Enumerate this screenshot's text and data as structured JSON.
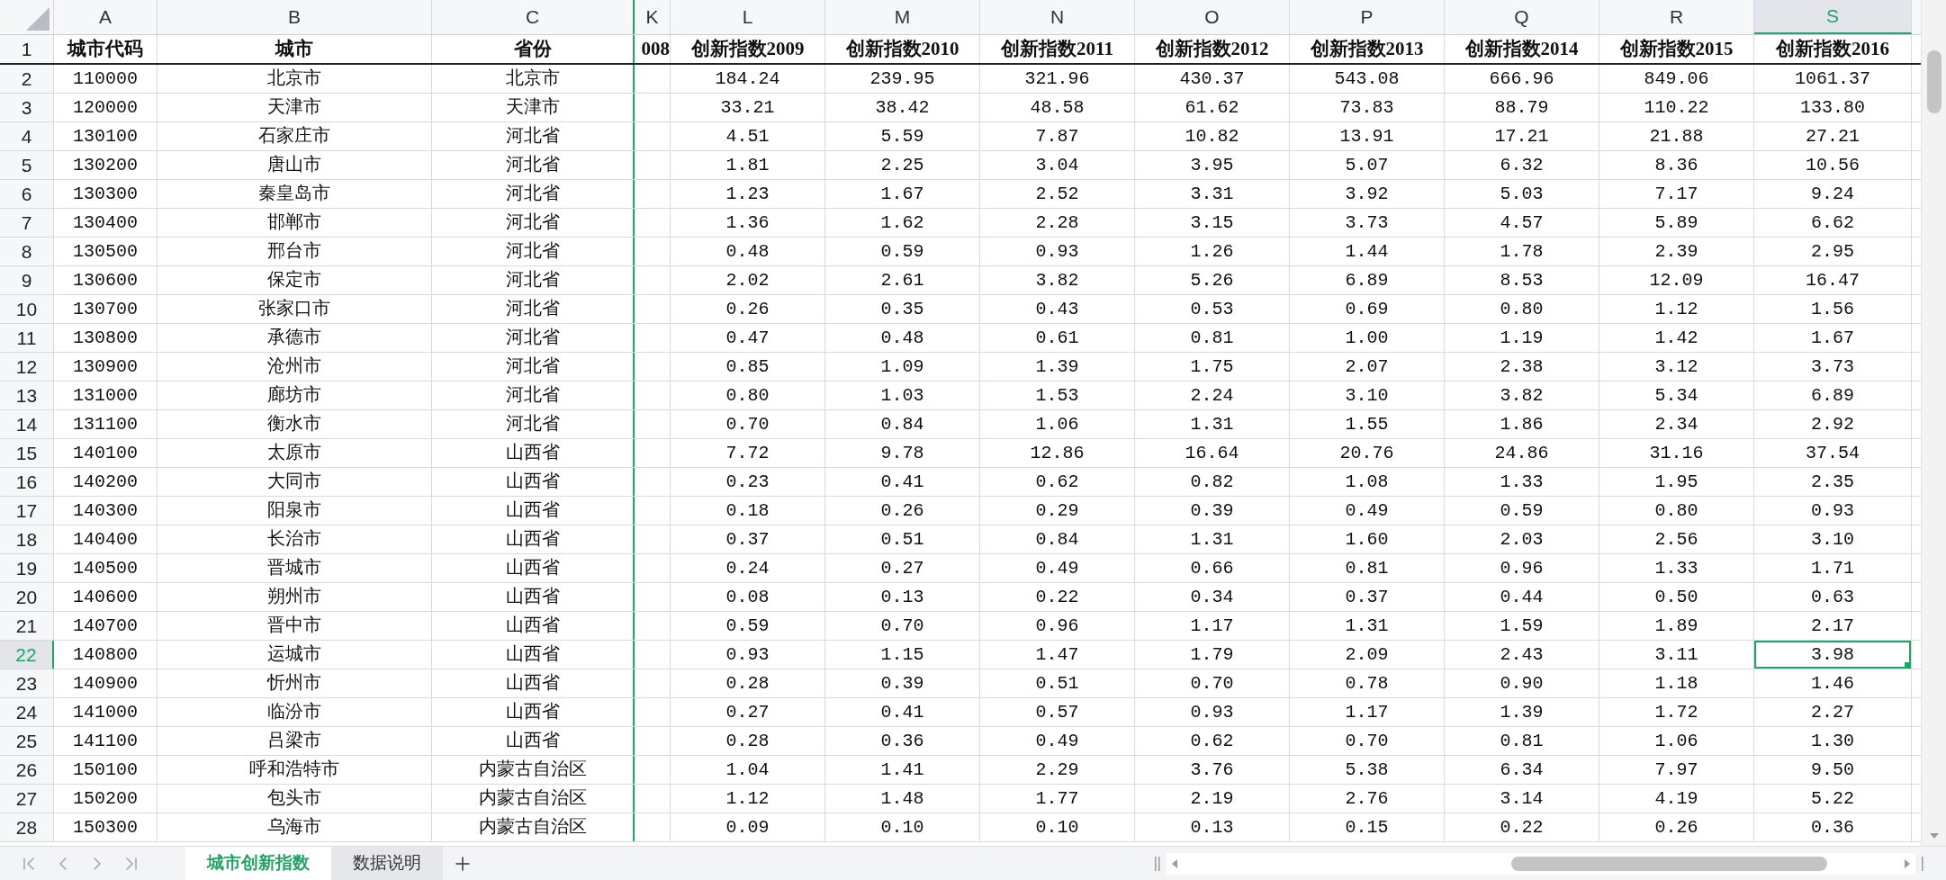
{
  "column_headers": [
    {
      "label": "A",
      "selected": false
    },
    {
      "label": "B",
      "selected": false
    },
    {
      "label": "C",
      "selected": false
    },
    {
      "label": "K",
      "selected": false
    },
    {
      "label": "L",
      "selected": false
    },
    {
      "label": "M",
      "selected": false
    },
    {
      "label": "N",
      "selected": false
    },
    {
      "label": "O",
      "selected": false
    },
    {
      "label": "P",
      "selected": false
    },
    {
      "label": "Q",
      "selected": false
    },
    {
      "label": "R",
      "selected": false
    },
    {
      "label": "S",
      "selected": true
    }
  ],
  "rows": [
    {
      "number": "1",
      "kind": "header",
      "selected": false,
      "cells": [
        "城市代码",
        "城市",
        "省份",
        "008",
        "创新指数2009",
        "创新指数2010",
        "创新指数2011",
        "创新指数2012",
        "创新指数2013",
        "创新指数2014",
        "创新指数2015",
        "创新指数2016"
      ]
    },
    {
      "number": "2",
      "kind": "data",
      "selected": false,
      "cells": [
        "110000",
        "北京市",
        "北京市",
        null,
        "184.24",
        "239.95",
        "321.96",
        "430.37",
        "543.08",
        "666.96",
        "849.06",
        "1061.37"
      ]
    },
    {
      "number": "3",
      "kind": "data",
      "selected": false,
      "cells": [
        "120000",
        "天津市",
        "天津市",
        null,
        "33.21",
        "38.42",
        "48.58",
        "61.62",
        "73.83",
        "88.79",
        "110.22",
        "133.80"
      ]
    },
    {
      "number": "4",
      "kind": "data",
      "selected": false,
      "cells": [
        "130100",
        "石家庄市",
        "河北省",
        null,
        "4.51",
        "5.59",
        "7.87",
        "10.82",
        "13.91",
        "17.21",
        "21.88",
        "27.21"
      ]
    },
    {
      "number": "5",
      "kind": "data",
      "selected": false,
      "cells": [
        "130200",
        "唐山市",
        "河北省",
        null,
        "1.81",
        "2.25",
        "3.04",
        "3.95",
        "5.07",
        "6.32",
        "8.36",
        "10.56"
      ]
    },
    {
      "number": "6",
      "kind": "data",
      "selected": false,
      "cells": [
        "130300",
        "秦皇岛市",
        "河北省",
        null,
        "1.23",
        "1.67",
        "2.52",
        "3.31",
        "3.92",
        "5.03",
        "7.17",
        "9.24"
      ]
    },
    {
      "number": "7",
      "kind": "data",
      "selected": false,
      "cells": [
        "130400",
        "邯郸市",
        "河北省",
        null,
        "1.36",
        "1.62",
        "2.28",
        "3.15",
        "3.73",
        "4.57",
        "5.89",
        "6.62"
      ]
    },
    {
      "number": "8",
      "kind": "data",
      "selected": false,
      "cells": [
        "130500",
        "邢台市",
        "河北省",
        null,
        "0.48",
        "0.59",
        "0.93",
        "1.26",
        "1.44",
        "1.78",
        "2.39",
        "2.95"
      ]
    },
    {
      "number": "9",
      "kind": "data",
      "selected": false,
      "cells": [
        "130600",
        "保定市",
        "河北省",
        null,
        "2.02",
        "2.61",
        "3.82",
        "5.26",
        "6.89",
        "8.53",
        "12.09",
        "16.47"
      ]
    },
    {
      "number": "10",
      "kind": "data",
      "selected": false,
      "cells": [
        "130700",
        "张家口市",
        "河北省",
        null,
        "0.26",
        "0.35",
        "0.43",
        "0.53",
        "0.69",
        "0.80",
        "1.12",
        "1.56"
      ]
    },
    {
      "number": "11",
      "kind": "data",
      "selected": false,
      "cells": [
        "130800",
        "承德市",
        "河北省",
        null,
        "0.47",
        "0.48",
        "0.61",
        "0.81",
        "1.00",
        "1.19",
        "1.42",
        "1.67"
      ]
    },
    {
      "number": "12",
      "kind": "data",
      "selected": false,
      "cells": [
        "130900",
        "沧州市",
        "河北省",
        null,
        "0.85",
        "1.09",
        "1.39",
        "1.75",
        "2.07",
        "2.38",
        "3.12",
        "3.73"
      ]
    },
    {
      "number": "13",
      "kind": "data",
      "selected": false,
      "cells": [
        "131000",
        "廊坊市",
        "河北省",
        null,
        "0.80",
        "1.03",
        "1.53",
        "2.24",
        "3.10",
        "3.82",
        "5.34",
        "6.89"
      ]
    },
    {
      "number": "14",
      "kind": "data",
      "selected": false,
      "cells": [
        "131100",
        "衡水市",
        "河北省",
        null,
        "0.70",
        "0.84",
        "1.06",
        "1.31",
        "1.55",
        "1.86",
        "2.34",
        "2.92"
      ]
    },
    {
      "number": "15",
      "kind": "data",
      "selected": false,
      "cells": [
        "140100",
        "太原市",
        "山西省",
        null,
        "7.72",
        "9.78",
        "12.86",
        "16.64",
        "20.76",
        "24.86",
        "31.16",
        "37.54"
      ]
    },
    {
      "number": "16",
      "kind": "data",
      "selected": false,
      "cells": [
        "140200",
        "大同市",
        "山西省",
        null,
        "0.23",
        "0.41",
        "0.62",
        "0.82",
        "1.08",
        "1.33",
        "1.95",
        "2.35"
      ]
    },
    {
      "number": "17",
      "kind": "data",
      "selected": false,
      "cells": [
        "140300",
        "阳泉市",
        "山西省",
        null,
        "0.18",
        "0.26",
        "0.29",
        "0.39",
        "0.49",
        "0.59",
        "0.80",
        "0.93"
      ]
    },
    {
      "number": "18",
      "kind": "data",
      "selected": false,
      "cells": [
        "140400",
        "长治市",
        "山西省",
        null,
        "0.37",
        "0.51",
        "0.84",
        "1.31",
        "1.60",
        "2.03",
        "2.56",
        "3.10"
      ]
    },
    {
      "number": "19",
      "kind": "data",
      "selected": false,
      "cells": [
        "140500",
        "晋城市",
        "山西省",
        null,
        "0.24",
        "0.27",
        "0.49",
        "0.66",
        "0.81",
        "0.96",
        "1.33",
        "1.71"
      ]
    },
    {
      "number": "20",
      "kind": "data",
      "selected": false,
      "cells": [
        "140600",
        "朔州市",
        "山西省",
        null,
        "0.08",
        "0.13",
        "0.22",
        "0.34",
        "0.37",
        "0.44",
        "0.50",
        "0.63"
      ]
    },
    {
      "number": "21",
      "kind": "data",
      "selected": false,
      "cells": [
        "140700",
        "晋中市",
        "山西省",
        null,
        "0.59",
        "0.70",
        "0.96",
        "1.17",
        "1.31",
        "1.59",
        "1.89",
        "2.17"
      ]
    },
    {
      "number": "22",
      "kind": "data",
      "selected": true,
      "cells": [
        "140800",
        "运城市",
        "山西省",
        null,
        "0.93",
        "1.15",
        "1.47",
        "1.79",
        "2.09",
        "2.43",
        "3.11",
        "3.98"
      ]
    },
    {
      "number": "23",
      "kind": "data",
      "selected": false,
      "cells": [
        "140900",
        "忻州市",
        "山西省",
        null,
        "0.28",
        "0.39",
        "0.51",
        "0.70",
        "0.78",
        "0.90",
        "1.18",
        "1.46"
      ]
    },
    {
      "number": "24",
      "kind": "data",
      "selected": false,
      "cells": [
        "141000",
        "临汾市",
        "山西省",
        null,
        "0.27",
        "0.41",
        "0.57",
        "0.93",
        "1.17",
        "1.39",
        "1.72",
        "2.27"
      ]
    },
    {
      "number": "25",
      "kind": "data",
      "selected": false,
      "cells": [
        "141100",
        "吕梁市",
        "山西省",
        null,
        "0.28",
        "0.36",
        "0.49",
        "0.62",
        "0.70",
        "0.81",
        "1.06",
        "1.30"
      ]
    },
    {
      "number": "26",
      "kind": "data",
      "selected": false,
      "cells": [
        "150100",
        "呼和浩特市",
        "内蒙古自治区",
        null,
        "1.04",
        "1.41",
        "2.29",
        "3.76",
        "5.38",
        "6.34",
        "7.97",
        "9.50"
      ]
    },
    {
      "number": "27",
      "kind": "data",
      "selected": false,
      "cells": [
        "150200",
        "包头市",
        "内蒙古自治区",
        null,
        "1.12",
        "1.48",
        "1.77",
        "2.19",
        "2.76",
        "3.14",
        "4.19",
        "5.22"
      ]
    },
    {
      "number": "28",
      "kind": "data",
      "selected": false,
      "cells": [
        "150300",
        "乌海市",
        "内蒙古自治区",
        null,
        "0.09",
        "0.10",
        "0.10",
        "0.13",
        "0.15",
        "0.22",
        "0.26",
        "0.36"
      ]
    }
  ],
  "sheet_tabs": [
    {
      "label": "城市创新指数",
      "selected": true
    },
    {
      "label": "数据说明",
      "selected": false
    }
  ]
}
